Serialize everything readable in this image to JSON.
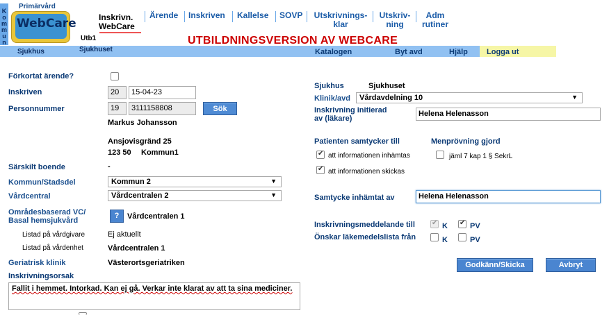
{
  "header": {
    "kommun": "Kommun",
    "primarvard": "Primärvård",
    "logo": "WebCare",
    "utb": "Utb1",
    "sjukhuset": "Sjukhuset",
    "sjukhus_tab": "Sjukhus",
    "banner": "UTBILDNINGSVERSION AV WEBCARE",
    "nav": {
      "inskrivn_line1": "Inskrivn.",
      "inskrivn_line2": "WebCare",
      "arende": "Ärende",
      "inskriven": "Inskriven",
      "kallelse": "Kallelse",
      "sovp": "SOVP",
      "utskrivningsklar_1": "Utskrivnings-",
      "utskrivningsklar_2": "klar",
      "utskrivning_1": "Utskriv-",
      "utskrivning_2": "ning",
      "adm_1": "Adm",
      "adm_2": "rutiner"
    },
    "links": {
      "katalogen": "Katalogen",
      "byt_avd": "Byt avd",
      "hjalp": "Hjälp",
      "logga_ut": "Logga ut"
    }
  },
  "form_left": {
    "forkortat_label": "Förkortat ärende?",
    "inskriven_label": "Inskriven",
    "inskriven_century": "20",
    "inskriven_date": "15-04-23",
    "personnummer_label": "Personnummer",
    "pnr_century": "19",
    "pnr_number": "3111158808",
    "sok_button": "Sök",
    "patient_name": "Markus Johansson",
    "address_street": "Ansjovisgränd 25",
    "address_postal": "123 50",
    "address_city": "Kommun1",
    "sarskilt_label": "Särskilt boende",
    "sarskilt_value": "-",
    "kommun_label": "Kommun/Stadsdel",
    "kommun_value": "Kommun 2",
    "vardcentral_label": "Vårdcentral",
    "vardcentral_value": "Vårdcentralen 2",
    "omradesbaserad_label_1": "Områdesbaserad VC/",
    "omradesbaserad_label_2": "Basal hemsjukvård",
    "omradesbaserad_q": "?",
    "omradesbaserad_value": "Vårdcentralen 1",
    "listad_vardgivare_label": "Listad på vårdgivare",
    "listad_vardgivare_value": "Ej aktuellt",
    "listad_vardenhet_label": "Listad på vårdenhet",
    "listad_vardenhet_value": "Vårdcentralen 1",
    "geriatrisk_label": "Geriatrisk klinik",
    "geriatrisk_value": "Västerortsgeriatriken",
    "inskrivningsorsak_label": "Inskrivningsorsak",
    "inskrivningsorsak_value": "Fallit i hemmet. Intorkad. Kan ej gå. Verkar inte klarat av att ta sina mediciner."
  },
  "form_right": {
    "sjukhus_label": "Sjukhus",
    "sjukhus_value": "Sjukhuset",
    "klinik_label": "Klinik/avd",
    "klinik_value": "Vårdavdelning 10",
    "initierad_label_1": "Inskrivning initierad",
    "initierad_label_2": "av (läkare)",
    "initierad_value": "Helena Helenasson",
    "samtycker_label": "Patienten samtycker till",
    "samtycker_1": "att informationen inhämtas",
    "samtycker_2": "att informationen skickas",
    "menprovning_label": "Menprövning gjord",
    "menprovning_option": "jäml 7 kap 1 § SekrL",
    "samtycke_label": "Samtycke inhämtat av",
    "samtycke_value": "Helena Helenasson",
    "meddelande_label": "Inskrivningsmeddelande till",
    "lakemedel_label": "Önskar läkemedelslista från",
    "k_label": "K",
    "pv_label": "PV",
    "godkann_button": "Godkänn/Skicka",
    "avbryt_button": "Avbryt"
  }
}
